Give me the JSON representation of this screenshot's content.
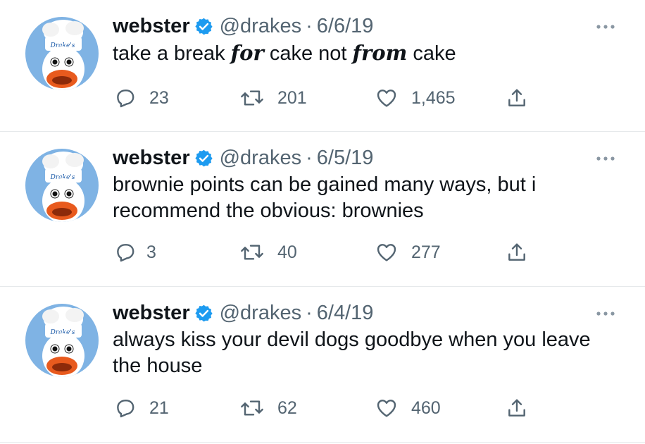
{
  "tweets": [
    {
      "author": "webster",
      "handle": "@drakes",
      "separator": "·",
      "date": "6/6/19",
      "text_parts": [
        "take a break ",
        "for",
        " cake not ",
        "from",
        " cake"
      ],
      "replies": "23",
      "retweets": "201",
      "likes": "1,465",
      "avatar_text": "Drake's"
    },
    {
      "author": "webster",
      "handle": "@drakes",
      "separator": "·",
      "date": "6/5/19",
      "text": "brownie points can be gained many ways, but i\nrecommend the obvious: brownies",
      "replies": "3",
      "retweets": "40",
      "likes": "277",
      "avatar_text": "Drake's"
    },
    {
      "author": "webster",
      "handle": "@drakes",
      "separator": "·",
      "date": "6/4/19",
      "text": "always kiss your devil dogs goodbye when you leave\nthe house",
      "replies": "21",
      "retweets": "62",
      "likes": "460",
      "avatar_text": "Drake's"
    }
  ],
  "icons": {
    "verified": "verified-badge-icon",
    "more": "more-dots-icon",
    "reply": "reply-bubble-icon",
    "retweet": "retweet-arrows-icon",
    "like": "heart-icon",
    "share": "share-upload-icon"
  },
  "colors": {
    "text": "#0f1419",
    "muted": "#536471",
    "verified": "#1d9bf0",
    "avatar_bg": "#7fb3e4",
    "duck_bill": "#e85a1e",
    "divider": "#e6e9eb"
  }
}
